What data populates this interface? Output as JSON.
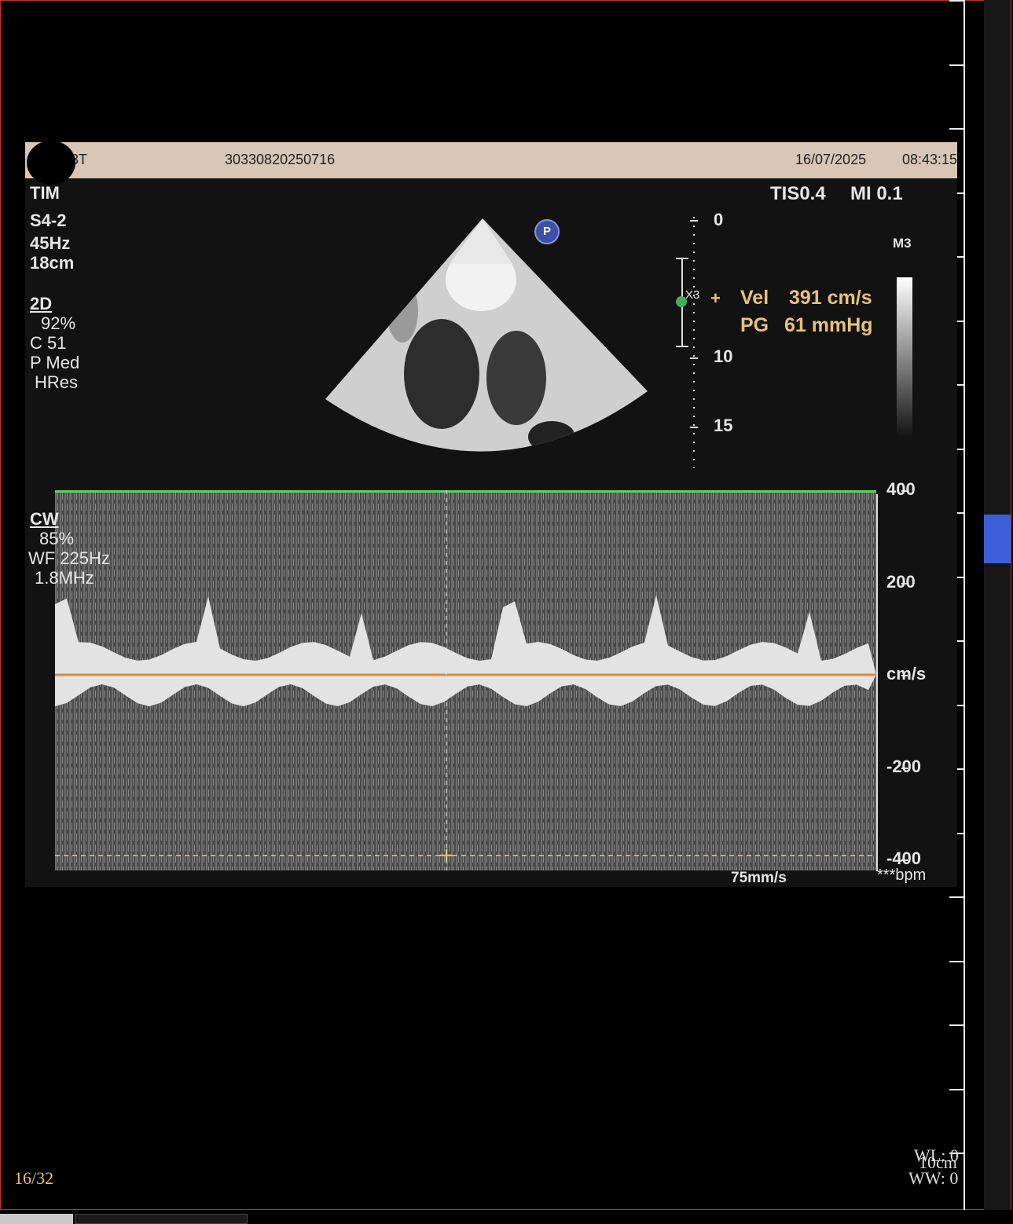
{
  "header": {
    "patient_suffix": "3T",
    "study_id": "30330820250716",
    "date": "16/07/2025",
    "time": "08:43:15"
  },
  "left_params": {
    "mode_partial": "TIM",
    "probe": "S4-2",
    "frame_rate": "45Hz",
    "depth": "18cm",
    "twod_label": "2D",
    "twod_gain": "92%",
    "compression": "C 51",
    "power": "P Med",
    "resolution": "HRes"
  },
  "indices": {
    "tis": "TIS0.4",
    "mi": "MI 0.1"
  },
  "colormap_label": "M3",
  "depth_scale": [
    "0",
    "10",
    "15"
  ],
  "zoom_label": "X3",
  "marker_badge": "P",
  "measurement": {
    "vel_label": "Vel",
    "vel_value": "391 cm/s",
    "pg_label": "PG",
    "pg_value": "61 mmHg"
  },
  "doppler": {
    "mode_label": "CW",
    "gain": "85%",
    "wall_filter": "WF 225Hz",
    "frequency": "1.8MHz",
    "sweep_speed": "75mm/s",
    "hr": "***bpm"
  },
  "chart_data": {
    "type": "area",
    "ylabel": "cm/s",
    "y_ticks": [
      "400",
      "200",
      "cm/s",
      "-200",
      "-400"
    ],
    "ylim": [
      -400,
      400
    ],
    "baseline": 0,
    "scale_top_marker": 400,
    "measured_velocity": 391,
    "measured_unit": "cm/s"
  },
  "viewer": {
    "frame_counter": "16/32",
    "wl": "WL: 0",
    "scale": "10cm",
    "ww": "WW: 0"
  },
  "colors": {
    "header_bg": "#d8c7b6",
    "measure_text": "#e8c27a",
    "baseline": "#d98a3b",
    "top_line": "#5bd35b",
    "scroll_thumb": "#3a5fd9"
  }
}
